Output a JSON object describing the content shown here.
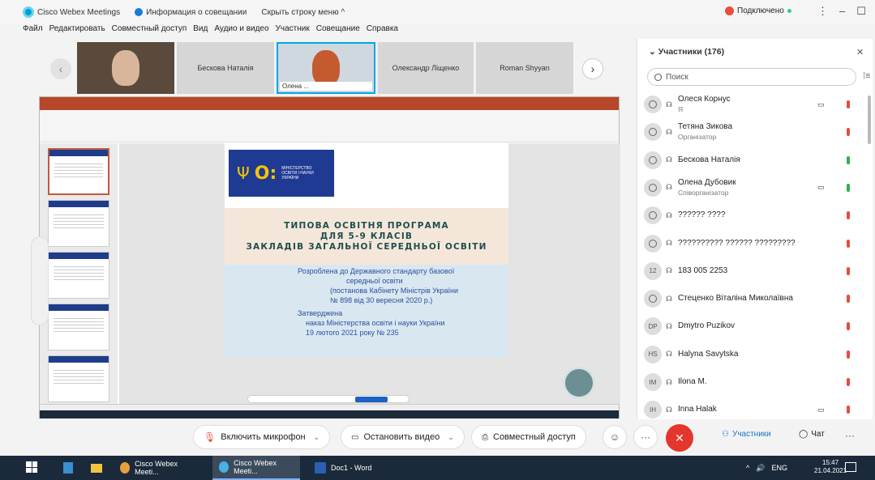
{
  "titlebar": {
    "app_name": "Cisco Webex Meetings",
    "meeting_info": "Информация о совещании",
    "hide_menu": "Скрыть строку меню ^",
    "connection": "Подключено",
    "window_controls": [
      "⋮",
      "–",
      "☐",
      "✕"
    ]
  },
  "menu": [
    "Файл",
    "Редактировать",
    "Совместный доступ",
    "Вид",
    "Аудио и видео",
    "Участник",
    "Совещание",
    "Справка"
  ],
  "video_strip": {
    "tiles": [
      {
        "name": "Бескова Наталія"
      },
      {
        "name": "Олена ..."
      },
      {
        "name": "Олександр Ліщенко"
      },
      {
        "name": "Roman Shyyan"
      }
    ]
  },
  "slide": {
    "band_lines": [
      "ТИПОВА ОСВІТНЯ ПРОГРАМА",
      "ДЛЯ 5-9 КЛАСІВ",
      "ЗАКЛАДІВ ЗАГАЛЬНОЇ СЕРЕДНЬОЇ ОСВІТИ"
    ],
    "logo_text": "Міністерство освіти і науки України",
    "body": {
      "developed": "Розроблена  до Державного стандарту базової",
      "developed2": "середньої освіти",
      "resolution": "(постанова Кабінету Міністрів України",
      "resolution2": "№ 898 від 30 вересня 2020 р.)",
      "approved": "Затверджена",
      "order": "наказ Міністерства освіти і науки України",
      "order2": "19 лютого 2021 року № 235"
    }
  },
  "participants": {
    "header": "Участники (176)",
    "search_placeholder": "Поиск",
    "list": [
      {
        "avatar": "",
        "name": "Олеся Корнус",
        "role": "Я",
        "camera": true,
        "mic": "muted"
      },
      {
        "avatar": "",
        "name": "Тетяна Зикова",
        "role": "Організатор",
        "camera": false,
        "mic": "muted"
      },
      {
        "avatar": "",
        "name": "Бескова Наталія",
        "role": "",
        "camera": false,
        "mic": "on"
      },
      {
        "avatar": "",
        "name": "Олена Дубовик",
        "role": "Співорганізатор",
        "camera": true,
        "mic": "on"
      },
      {
        "avatar": "",
        "name": "?????? ????",
        "role": "",
        "camera": false,
        "mic": "muted"
      },
      {
        "avatar": "",
        "name": "?????????? ?????? ?????????",
        "role": "",
        "camera": false,
        "mic": "muted"
      },
      {
        "avatar": "12",
        "name": "183 005 2253",
        "role": "",
        "camera": false,
        "mic": "muted"
      },
      {
        "avatar": "",
        "name": "Стеценко Віталіна Миколаївна",
        "role": "",
        "camera": false,
        "mic": "muted"
      },
      {
        "avatar": "DP",
        "name": "Dmytro Puzikov",
        "role": "",
        "camera": false,
        "mic": "muted"
      },
      {
        "avatar": "HS",
        "name": "Halyna Savytska",
        "role": "",
        "camera": false,
        "mic": "muted"
      },
      {
        "avatar": "IM",
        "name": "Ilona M.",
        "role": "",
        "camera": false,
        "mic": "muted"
      },
      {
        "avatar": "IH",
        "name": "Inna Halak",
        "role": "",
        "camera": true,
        "mic": "muted"
      }
    ]
  },
  "controls": {
    "mic": "Включить микрофон",
    "video": "Остановить видео",
    "share": "Совместный доступ",
    "participants": "Участники",
    "chat": "Чат"
  },
  "taskbar": {
    "apps": [
      "Cisco Webex Meeti...",
      "Cisco Webex Meeti...",
      "Doc1 - Word"
    ],
    "lang": "ENG",
    "time": "15:47",
    "date": "21.04.2021"
  },
  "colors": {
    "accent": "#1a73c8",
    "end_call": "#e4362d",
    "mic_muted": "#e74c3c",
    "mic_on": "#2bb24c",
    "ppt_red": "#b7472a",
    "moe_blue": "#1f3a93"
  }
}
